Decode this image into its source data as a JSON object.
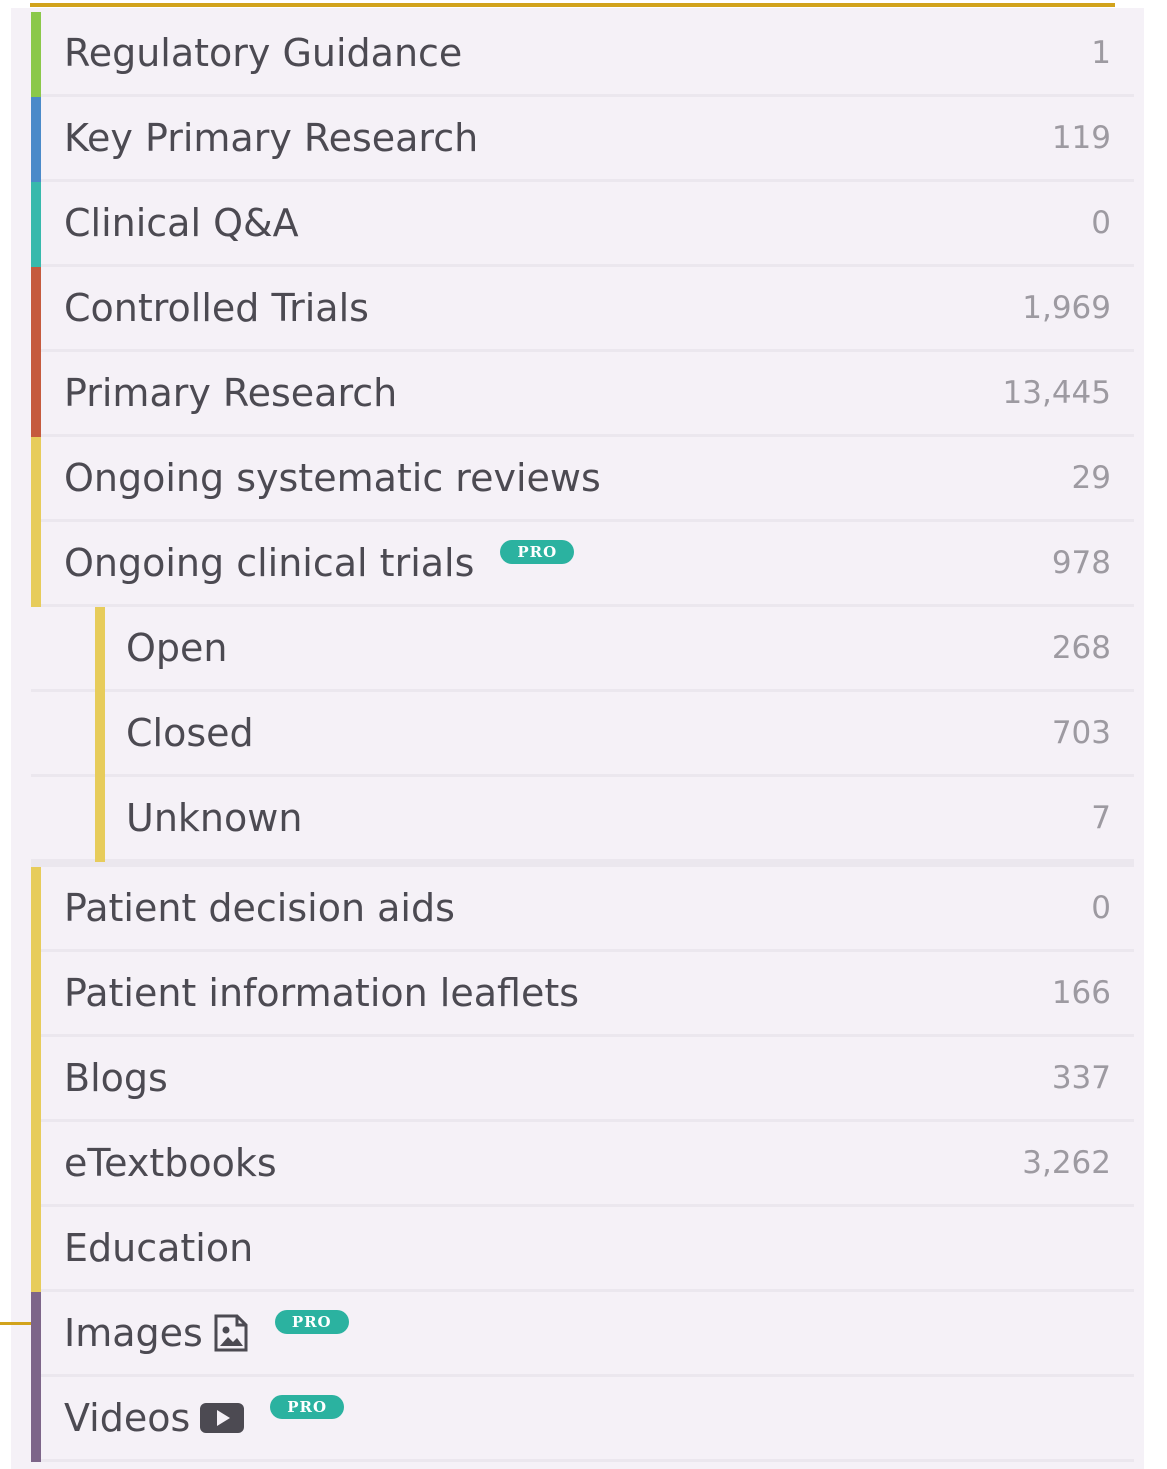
{
  "pro_badge": "PRO",
  "colors": {
    "green": "#8bc84a",
    "blue": "#4a8ac9",
    "teal": "#37b9ac",
    "red": "#c55a3e",
    "yellow": "#e7cc5b",
    "purple": "#7d6589",
    "accent_rule": "#d2a31c",
    "pro_badge": "#2bb2a0"
  },
  "categories": [
    {
      "label": "Regulatory Guidance",
      "count": "1",
      "color": "green"
    },
    {
      "label": "Key Primary Research",
      "count": "119",
      "color": "blue"
    },
    {
      "label": "Clinical Q&A",
      "count": "0",
      "color": "teal"
    },
    {
      "label": "Controlled Trials",
      "count": "1,969",
      "color": "red"
    },
    {
      "label": "Primary Research",
      "count": "13,445",
      "color": "red"
    },
    {
      "label": "Ongoing systematic reviews",
      "count": "29",
      "color": "yellow"
    },
    {
      "label": "Ongoing clinical trials",
      "count": "978",
      "color": "yellow",
      "pro": true
    },
    {
      "label": "Open",
      "count": "268",
      "color": "yellow",
      "sub": true
    },
    {
      "label": "Closed",
      "count": "703",
      "color": "yellow",
      "sub": true
    },
    {
      "label": "Unknown",
      "count": "7",
      "color": "yellow",
      "sub": true
    },
    {
      "label": "Patient decision aids",
      "count": "0",
      "color": "yellow"
    },
    {
      "label": "Patient information leaflets",
      "count": "166",
      "color": "yellow"
    },
    {
      "label": "Blogs",
      "count": "337",
      "color": "yellow"
    },
    {
      "label": "eTextbooks",
      "count": "3,262",
      "color": "yellow"
    },
    {
      "label": "Education",
      "count": "",
      "color": "yellow"
    },
    {
      "label": "Images",
      "count": "",
      "color": "purple",
      "pro": true,
      "icon": "image-icon"
    },
    {
      "label": "Videos",
      "count": "",
      "color": "purple",
      "pro": true,
      "icon": "video-icon"
    }
  ]
}
